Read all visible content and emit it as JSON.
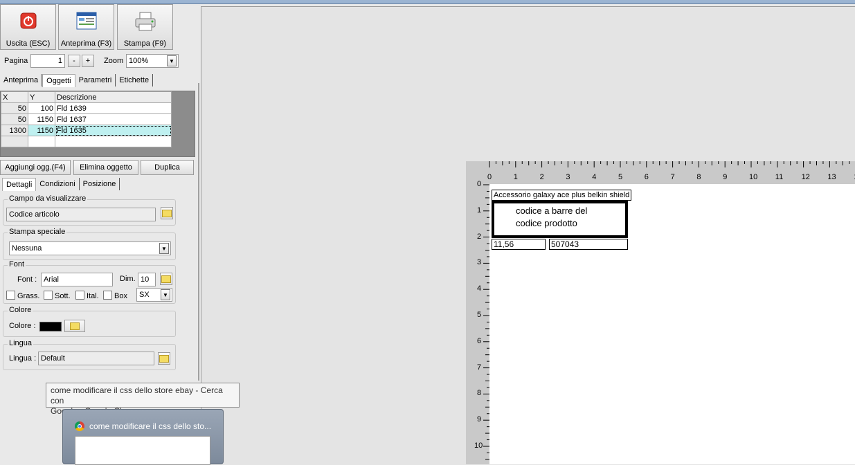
{
  "toolbar": {
    "exit_label": "Uscita (ESC)",
    "preview_label": "Anteprima (F3)",
    "print_label": "Stampa (F9)"
  },
  "pagination": {
    "page_label": "Pagina",
    "page_value": "1",
    "minus": "-",
    "plus": "+",
    "zoom_label": "Zoom",
    "zoom_value": "100%"
  },
  "main_tabs": [
    "Anteprima",
    "Oggetti",
    "Parametri",
    "Etichette"
  ],
  "objects_table": {
    "columns": [
      "X",
      "Y",
      "Descrizione"
    ],
    "rows": [
      {
        "x": "50",
        "y": "100",
        "desc": "Fld 1639"
      },
      {
        "x": "50",
        "y": "1150",
        "desc": "Fld 1637"
      },
      {
        "x": "1300",
        "y": "1150",
        "desc": "Fld 1635"
      }
    ]
  },
  "actions": {
    "add": "Aggiungi ogg.(F4)",
    "delete": "Elimina oggetto",
    "duplicate": "Duplica"
  },
  "detail_tabs": [
    "Dettagli",
    "Condizioni",
    "Posizione"
  ],
  "field_group": {
    "legend": "Campo da visualizzare",
    "value": "Codice articolo"
  },
  "special_group": {
    "legend": "Stampa speciale",
    "value": "Nessuna"
  },
  "font_group": {
    "legend": "Font",
    "font_label": "Font :",
    "font_value": "Arial",
    "size_label": "Dim.",
    "size_value": "10",
    "bold": "Grass.",
    "underline": "Sott.",
    "italic": "Ital.",
    "box": "Box",
    "align_value": "SX"
  },
  "color_group": {
    "legend": "Colore",
    "label": "Colore :",
    "swatch": "#000000"
  },
  "language_group": {
    "legend": "Lingua",
    "label": "Lingua :",
    "value": "Default"
  },
  "taskbar": {
    "tooltip_line1": "come modificare il css dello store ebay - Cerca con",
    "tooltip_line2": "Google - Google Chrome",
    "thumb_title": "come modificare il css dello sto..."
  },
  "preview": {
    "ruler_h": [
      "0",
      "1",
      "2",
      "3",
      "4",
      "5",
      "6",
      "7",
      "8",
      "9",
      "10",
      "11",
      "12",
      "13",
      "1"
    ],
    "ruler_v": [
      "0",
      "1",
      "2",
      "3",
      "4",
      "5",
      "6",
      "7",
      "8",
      "9",
      "10"
    ],
    "field_description": "Accessorio galaxy ace plus belkin shield",
    "barcode_line1": "codice a barre del",
    "barcode_line2": "codice prodotto",
    "field_price": "11,56",
    "field_code": "507043"
  }
}
